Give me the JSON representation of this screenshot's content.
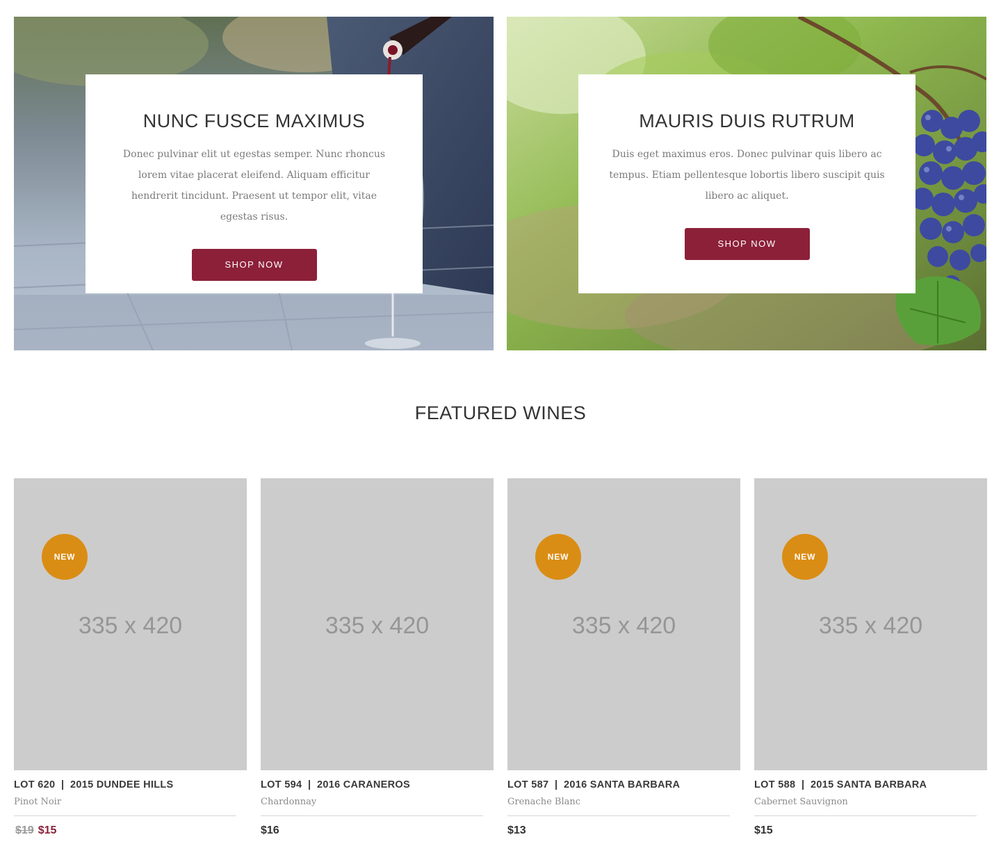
{
  "promos": [
    {
      "title": "NUNC FUSCE MAXIMUS",
      "text": "Donec pulvinar elit ut egestas semper. Nunc rhoncus lorem vitae placerat eleifend. Aliquam efficitur hendrerit tincidunt. Praesent ut tempor elit, vitae egestas risus.",
      "button_label": "SHOP NOW"
    },
    {
      "title": "MAURIS DUIS RUTRUM",
      "text": "Duis eget maximus eros. Donec pulvinar quis libero ac tempus. Etiam pellentesque lobortis libero suscipit quis libero ac aliquet.",
      "button_label": "SHOP NOW"
    }
  ],
  "featured": {
    "title": "FEATURED WINES",
    "products": [
      {
        "placeholder": "335 x 420",
        "badge": "NEW",
        "lot": "LOT 620  |  2015 DUNDEE HILLS",
        "varietal": "Pinot Noir",
        "old_price": "$19",
        "price": "$15"
      },
      {
        "placeholder": "335 x 420",
        "lot": "LOT 594  |  2016 CARANEROS",
        "varietal": "Chardonnay",
        "price": "$16"
      },
      {
        "placeholder": "335 x 420",
        "badge": "NEW",
        "lot": "LOT 587  |  2016 SANTA BARBARA",
        "varietal": "Grenache Blanc",
        "price": "$13"
      },
      {
        "placeholder": "335 x 420",
        "badge": "NEW",
        "lot": "LOT 588  |  2015 SANTA BARBARA",
        "varietal": "Cabernet Sauvignon",
        "price": "$15"
      }
    ]
  },
  "colors": {
    "brand": "#8c2039",
    "badge": "#da8d14",
    "placeholder": "#cccccc"
  }
}
